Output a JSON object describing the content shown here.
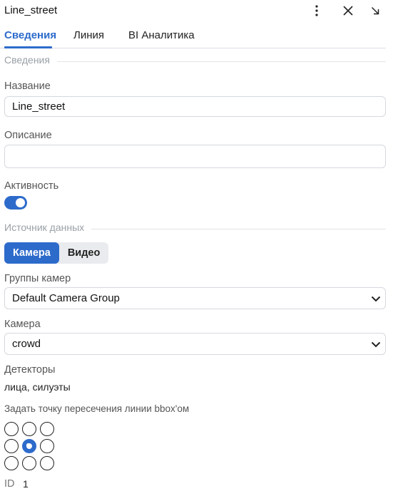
{
  "header": {
    "title": "Line_street",
    "more_icon": "more-vertical-icon",
    "close_icon": "close-icon",
    "collapse_icon": "arrow-down-right-icon"
  },
  "tabs": [
    {
      "label": "Сведения",
      "active": true
    },
    {
      "label": "Линия",
      "active": false
    },
    {
      "label": "BI Аналитика",
      "active": false
    }
  ],
  "info_section": {
    "label": "Сведения"
  },
  "name_field": {
    "label": "Название",
    "value": "Line_street"
  },
  "description_field": {
    "label": "Описание",
    "value": ""
  },
  "activity": {
    "label": "Активность",
    "enabled": true
  },
  "source_section": {
    "label": "Источник данных"
  },
  "source_switch": {
    "options": [
      "Камера",
      "Видео"
    ],
    "selected": "Камера"
  },
  "camera_groups": {
    "label": "Группы камер",
    "value": "Default Camera Group"
  },
  "camera": {
    "label": "Камера",
    "value": "crowd"
  },
  "detectors": {
    "label": "Детекторы",
    "value": "лица, силуэты"
  },
  "bbox_point": {
    "label": "Задать точку пересечения линии bbox'ом",
    "selected_row": 2,
    "selected_col": 2
  },
  "id_row": {
    "label": "ID",
    "value": "1"
  },
  "colors": {
    "accent": "#2d6bcb",
    "border": "#d5d8dd",
    "muted": "#9aa0a6"
  }
}
